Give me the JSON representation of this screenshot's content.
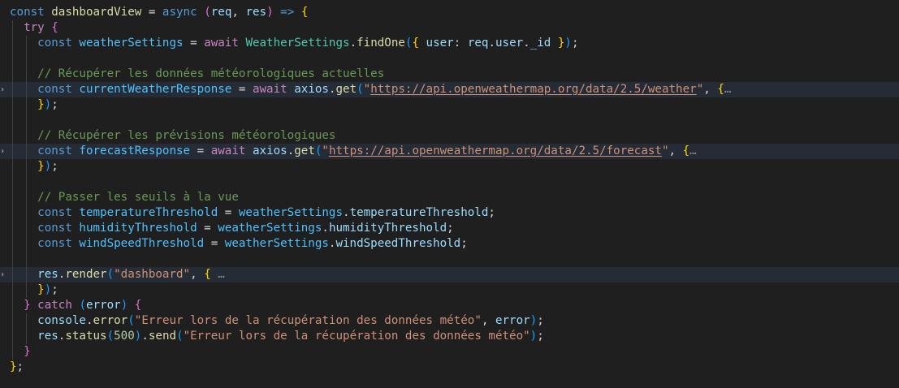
{
  "editor": {
    "lines": [
      {
        "fold": false,
        "highlight": false,
        "guides": 0,
        "tokens": [
          {
            "t": "const ",
            "c": "kw-blue"
          },
          {
            "t": "dashboardView",
            "c": "fn"
          },
          {
            "t": " = ",
            "c": "pun"
          },
          {
            "t": "async",
            "c": "kw-blue"
          },
          {
            "t": " ",
            "c": "pun"
          },
          {
            "t": "(",
            "c": "b2"
          },
          {
            "t": "req",
            "c": "var"
          },
          {
            "t": ", ",
            "c": "pun"
          },
          {
            "t": "res",
            "c": "var"
          },
          {
            "t": ")",
            "c": "b2"
          },
          {
            "t": " ",
            "c": "pun"
          },
          {
            "t": "=>",
            "c": "kw-blue"
          },
          {
            "t": " ",
            "c": "pun"
          },
          {
            "t": "{",
            "c": "b1"
          }
        ]
      },
      {
        "fold": false,
        "highlight": false,
        "guides": 1,
        "tokens": [
          {
            "t": "  try",
            "c": "kw-ctl"
          },
          {
            "t": " ",
            "c": "pun"
          },
          {
            "t": "{",
            "c": "b2"
          }
        ]
      },
      {
        "fold": false,
        "highlight": false,
        "guides": 2,
        "tokens": [
          {
            "t": "    const ",
            "c": "kw-blue"
          },
          {
            "t": "weatherSettings",
            "c": "const"
          },
          {
            "t": " = ",
            "c": "pun"
          },
          {
            "t": "await",
            "c": "kw-ctl"
          },
          {
            "t": " ",
            "c": "pun"
          },
          {
            "t": "WeatherSettings",
            "c": "cls"
          },
          {
            "t": ".",
            "c": "pun"
          },
          {
            "t": "findOne",
            "c": "fn"
          },
          {
            "t": "(",
            "c": "b3"
          },
          {
            "t": "{",
            "c": "b1"
          },
          {
            "t": " user",
            "c": "var"
          },
          {
            "t": ": ",
            "c": "pun"
          },
          {
            "t": "req",
            "c": "var"
          },
          {
            "t": ".",
            "c": "pun"
          },
          {
            "t": "user",
            "c": "var"
          },
          {
            "t": ".",
            "c": "pun"
          },
          {
            "t": "_id",
            "c": "var"
          },
          {
            "t": " ",
            "c": "pun"
          },
          {
            "t": "}",
            "c": "b1"
          },
          {
            "t": ")",
            "c": "b3"
          },
          {
            "t": ";",
            "c": "pun"
          }
        ]
      },
      {
        "fold": false,
        "highlight": false,
        "guides": 2,
        "tokens": []
      },
      {
        "fold": false,
        "highlight": false,
        "guides": 2,
        "tokens": [
          {
            "t": "    // Récupérer les données météorologiques actuelles",
            "c": "cmt"
          }
        ]
      },
      {
        "fold": true,
        "highlight": true,
        "guides": 2,
        "tokens": [
          {
            "t": "    const ",
            "c": "kw-blue"
          },
          {
            "t": "currentWeatherResponse",
            "c": "const"
          },
          {
            "t": " = ",
            "c": "pun"
          },
          {
            "t": "await",
            "c": "kw-ctl"
          },
          {
            "t": " ",
            "c": "pun"
          },
          {
            "t": "axios",
            "c": "var"
          },
          {
            "t": ".",
            "c": "pun"
          },
          {
            "t": "get",
            "c": "fn"
          },
          {
            "t": "(",
            "c": "b3"
          },
          {
            "t": "\"",
            "c": "str"
          },
          {
            "t": "https://api.openweathermap.org/data/2.5/weather",
            "c": "str link"
          },
          {
            "t": "\"",
            "c": "str"
          },
          {
            "t": ", ",
            "c": "pun"
          },
          {
            "t": "{",
            "c": "b1"
          },
          {
            "t": "…",
            "c": "ell"
          }
        ]
      },
      {
        "fold": false,
        "highlight": false,
        "guides": 2,
        "tokens": [
          {
            "t": "    ",
            "c": "pun"
          },
          {
            "t": "}",
            "c": "b1"
          },
          {
            "t": ")",
            "c": "b3"
          },
          {
            "t": ";",
            "c": "pun"
          }
        ]
      },
      {
        "fold": false,
        "highlight": false,
        "guides": 2,
        "tokens": []
      },
      {
        "fold": false,
        "highlight": false,
        "guides": 2,
        "tokens": [
          {
            "t": "    // Récupérer les prévisions météorologiques",
            "c": "cmt"
          }
        ]
      },
      {
        "fold": true,
        "highlight": true,
        "guides": 2,
        "tokens": [
          {
            "t": "    const ",
            "c": "kw-blue"
          },
          {
            "t": "forecastResponse",
            "c": "const"
          },
          {
            "t": " = ",
            "c": "pun"
          },
          {
            "t": "await",
            "c": "kw-ctl"
          },
          {
            "t": " ",
            "c": "pun"
          },
          {
            "t": "axios",
            "c": "var"
          },
          {
            "t": ".",
            "c": "pun"
          },
          {
            "t": "get",
            "c": "fn"
          },
          {
            "t": "(",
            "c": "b3"
          },
          {
            "t": "\"",
            "c": "str"
          },
          {
            "t": "https://api.openweathermap.org/data/2.5/forecast",
            "c": "str link"
          },
          {
            "t": "\"",
            "c": "str"
          },
          {
            "t": ", ",
            "c": "pun"
          },
          {
            "t": "{",
            "c": "b1"
          },
          {
            "t": "…",
            "c": "ell"
          }
        ]
      },
      {
        "fold": false,
        "highlight": false,
        "guides": 2,
        "tokens": [
          {
            "t": "    ",
            "c": "pun"
          },
          {
            "t": "}",
            "c": "b1"
          },
          {
            "t": ")",
            "c": "b3"
          },
          {
            "t": ";",
            "c": "pun"
          }
        ]
      },
      {
        "fold": false,
        "highlight": false,
        "guides": 2,
        "tokens": []
      },
      {
        "fold": false,
        "highlight": false,
        "guides": 2,
        "tokens": [
          {
            "t": "    // Passer les seuils à la vue",
            "c": "cmt"
          }
        ]
      },
      {
        "fold": false,
        "highlight": false,
        "guides": 2,
        "tokens": [
          {
            "t": "    const ",
            "c": "kw-blue"
          },
          {
            "t": "temperatureThreshold",
            "c": "const"
          },
          {
            "t": " = ",
            "c": "pun"
          },
          {
            "t": "weatherSettings",
            "c": "const"
          },
          {
            "t": ".",
            "c": "pun"
          },
          {
            "t": "temperatureThreshold",
            "c": "var"
          },
          {
            "t": ";",
            "c": "pun"
          }
        ]
      },
      {
        "fold": false,
        "highlight": false,
        "guides": 2,
        "tokens": [
          {
            "t": "    const ",
            "c": "kw-blue"
          },
          {
            "t": "humidityThreshold",
            "c": "const"
          },
          {
            "t": " = ",
            "c": "pun"
          },
          {
            "t": "weatherSettings",
            "c": "const"
          },
          {
            "t": ".",
            "c": "pun"
          },
          {
            "t": "humidityThreshold",
            "c": "var"
          },
          {
            "t": ";",
            "c": "pun"
          }
        ]
      },
      {
        "fold": false,
        "highlight": false,
        "guides": 2,
        "tokens": [
          {
            "t": "    const ",
            "c": "kw-blue"
          },
          {
            "t": "windSpeedThreshold",
            "c": "const"
          },
          {
            "t": " = ",
            "c": "pun"
          },
          {
            "t": "weatherSettings",
            "c": "const"
          },
          {
            "t": ".",
            "c": "pun"
          },
          {
            "t": "windSpeedThreshold",
            "c": "var"
          },
          {
            "t": ";",
            "c": "pun"
          }
        ]
      },
      {
        "fold": false,
        "highlight": false,
        "guides": 2,
        "tokens": []
      },
      {
        "fold": true,
        "highlight": true,
        "guides": 2,
        "tokens": [
          {
            "t": "    res",
            "c": "var"
          },
          {
            "t": ".",
            "c": "pun"
          },
          {
            "t": "render",
            "c": "fn"
          },
          {
            "t": "(",
            "c": "b3"
          },
          {
            "t": "\"dashboard\"",
            "c": "str"
          },
          {
            "t": ", ",
            "c": "pun"
          },
          {
            "t": "{",
            "c": "b1"
          },
          {
            "t": " …",
            "c": "ell"
          }
        ]
      },
      {
        "fold": false,
        "highlight": false,
        "guides": 2,
        "tokens": [
          {
            "t": "    ",
            "c": "pun"
          },
          {
            "t": "}",
            "c": "b1"
          },
          {
            "t": ")",
            "c": "b3"
          },
          {
            "t": ";",
            "c": "pun"
          }
        ]
      },
      {
        "fold": false,
        "highlight": false,
        "guides": 1,
        "tokens": [
          {
            "t": "  ",
            "c": "pun"
          },
          {
            "t": "}",
            "c": "b2"
          },
          {
            "t": " catch",
            "c": "kw-ctl"
          },
          {
            "t": " ",
            "c": "pun"
          },
          {
            "t": "(",
            "c": "b3"
          },
          {
            "t": "error",
            "c": "var"
          },
          {
            "t": ")",
            "c": "b3"
          },
          {
            "t": " ",
            "c": "pun"
          },
          {
            "t": "{",
            "c": "b2"
          }
        ]
      },
      {
        "fold": false,
        "highlight": false,
        "guides": 2,
        "tokens": [
          {
            "t": "    console",
            "c": "var"
          },
          {
            "t": ".",
            "c": "pun"
          },
          {
            "t": "error",
            "c": "fn"
          },
          {
            "t": "(",
            "c": "b3"
          },
          {
            "t": "\"Erreur lors de la récupération des données météo\"",
            "c": "str"
          },
          {
            "t": ", ",
            "c": "pun"
          },
          {
            "t": "error",
            "c": "var"
          },
          {
            "t": ")",
            "c": "b3"
          },
          {
            "t": ";",
            "c": "pun"
          }
        ]
      },
      {
        "fold": false,
        "highlight": false,
        "guides": 2,
        "tokens": [
          {
            "t": "    res",
            "c": "var"
          },
          {
            "t": ".",
            "c": "pun"
          },
          {
            "t": "status",
            "c": "fn"
          },
          {
            "t": "(",
            "c": "b3"
          },
          {
            "t": "500",
            "c": "num"
          },
          {
            "t": ")",
            "c": "b3"
          },
          {
            "t": ".",
            "c": "pun"
          },
          {
            "t": "send",
            "c": "fn"
          },
          {
            "t": "(",
            "c": "b3"
          },
          {
            "t": "\"Erreur lors de la récupération des données météo\"",
            "c": "str"
          },
          {
            "t": ")",
            "c": "b3"
          },
          {
            "t": ";",
            "c": "pun"
          }
        ]
      },
      {
        "fold": false,
        "highlight": false,
        "guides": 1,
        "tokens": [
          {
            "t": "  ",
            "c": "pun"
          },
          {
            "t": "}",
            "c": "b2"
          }
        ]
      },
      {
        "fold": false,
        "highlight": false,
        "guides": 0,
        "tokens": [
          {
            "t": "}",
            "c": "b1"
          },
          {
            "t": ";",
            "c": "pun"
          }
        ]
      }
    ]
  }
}
